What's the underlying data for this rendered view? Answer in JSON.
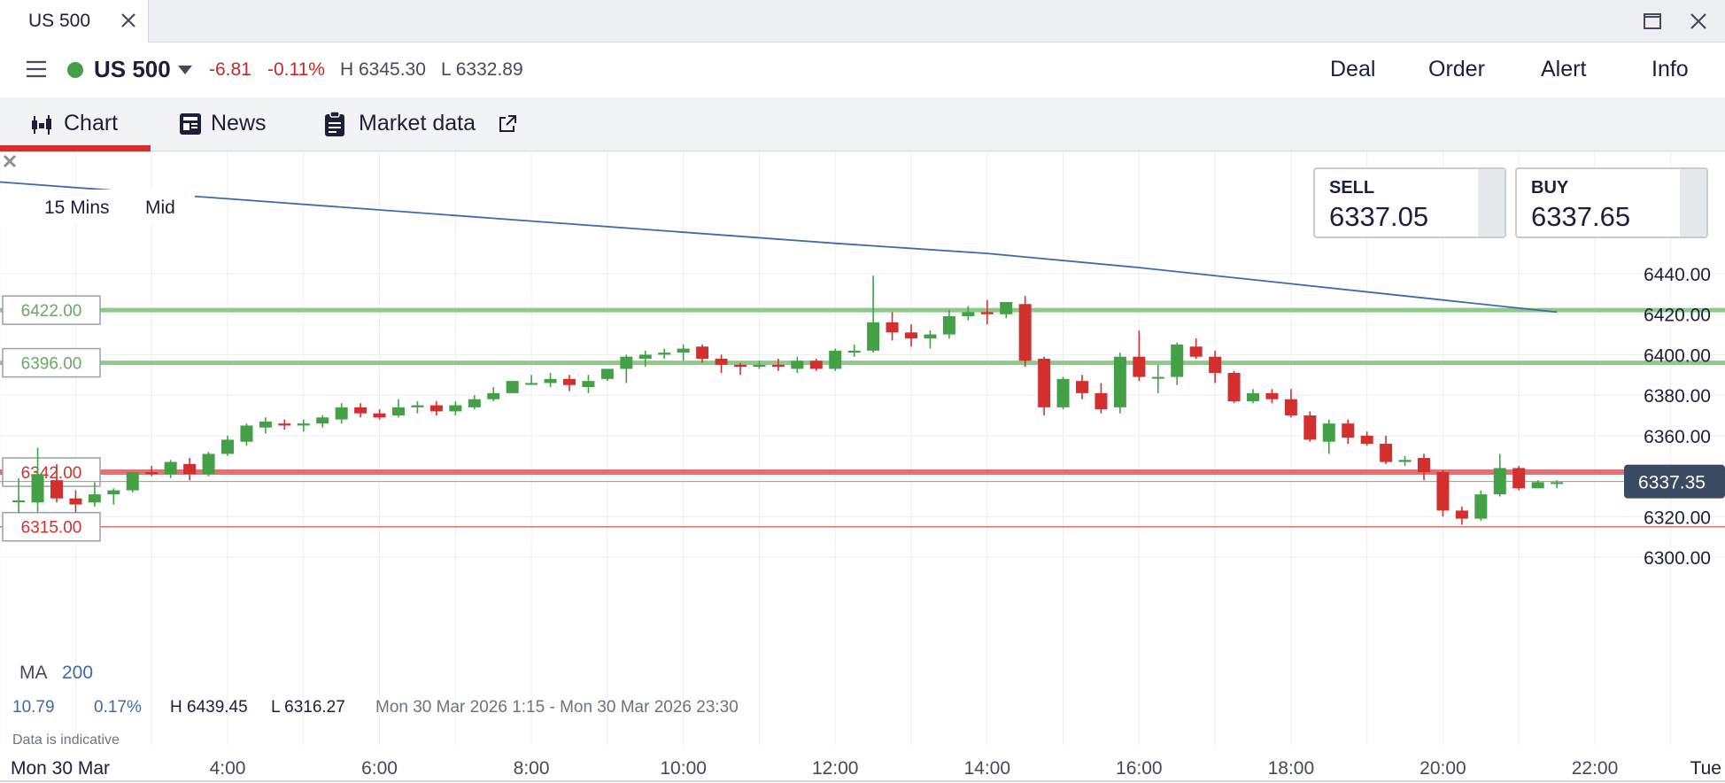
{
  "window": {
    "tab_title": "US 500"
  },
  "header": {
    "instrument": "US 500",
    "change": "-6.81",
    "change_pct": "-0.11%",
    "high": "H 6345.30",
    "low": "L 6332.89",
    "actions": [
      "Deal",
      "Order",
      "Alert",
      "Info"
    ]
  },
  "tabs": [
    {
      "label": "Chart",
      "active": true
    },
    {
      "label": "News",
      "active": false
    },
    {
      "label": "Market data",
      "active": false
    }
  ],
  "timeframe": {
    "interval": "15 Mins",
    "price_type": "Mid"
  },
  "quote": {
    "sell_label": "SELL",
    "sell_price": "6337.05",
    "buy_label": "BUY",
    "buy_price": "6337.65"
  },
  "indicator": {
    "name": "MA",
    "period": "200"
  },
  "stats": {
    "change": "10.79",
    "change_pct": "0.17%",
    "high": "H 6439.45",
    "low": "L 6316.27",
    "range": "Mon 30 Mar 2026 1:15 - Mon 30 Mar 2026 23:30"
  },
  "disclaimer": "Data is indicative",
  "colors": {
    "up": "#43a047",
    "down": "#d32f2f",
    "ma_line": "#3f6aa8",
    "price_tag": "#3b4a63",
    "accent": "#d32f2f"
  },
  "chart_data": {
    "type": "candlestick",
    "y_ticks": [
      "6440.00",
      "6420.00",
      "6400.00",
      "6380.00",
      "6360.00",
      "6320.00",
      "6300.00"
    ],
    "y_range": [
      6296,
      6486
    ],
    "x_ticks": [
      "4:00",
      "6:00",
      "8:00",
      "10:00",
      "12:00",
      "14:00",
      "16:00",
      "18:00",
      "20:00",
      "22:00"
    ],
    "x_start_label": "Mon 30 Mar",
    "x_end_label": "Tue",
    "current_price": "6337.35",
    "current_price_value": 6337.35,
    "levels": [
      {
        "label": "6422.00",
        "value": 6422,
        "kind": "green"
      },
      {
        "label": "6396.00",
        "value": 6396,
        "kind": "green"
      },
      {
        "label": "6342.00",
        "value": 6342,
        "kind": "red"
      },
      {
        "label": "6315.00",
        "value": 6315,
        "kind": "red-thin"
      }
    ],
    "candles": [
      {
        "t": "1:15",
        "o": 6328,
        "h": 6339,
        "l": 6322,
        "c": 6328
      },
      {
        "t": "1:30",
        "o": 6327,
        "h": 6354,
        "l": 6322,
        "c": 6341
      },
      {
        "t": "1:45",
        "o": 6338,
        "h": 6346,
        "l": 6327,
        "c": 6329
      },
      {
        "t": "2:00",
        "o": 6329,
        "h": 6333,
        "l": 6322,
        "c": 6326
      },
      {
        "t": "2:15",
        "o": 6327,
        "h": 6337,
        "l": 6325,
        "c": 6331
      },
      {
        "t": "2:30",
        "o": 6331,
        "h": 6334,
        "l": 6326,
        "c": 6333
      },
      {
        "t": "2:45",
        "o": 6333,
        "h": 6342,
        "l": 6332,
        "c": 6342
      },
      {
        "t": "3:00",
        "o": 6342,
        "h": 6345,
        "l": 6340,
        "c": 6341
      },
      {
        "t": "3:15",
        "o": 6341,
        "h": 6348,
        "l": 6339,
        "c": 6347
      },
      {
        "t": "3:30",
        "o": 6346,
        "h": 6349,
        "l": 6338,
        "c": 6341
      },
      {
        "t": "3:45",
        "o": 6341,
        "h": 6352,
        "l": 6340,
        "c": 6351
      },
      {
        "t": "4:00",
        "o": 6351,
        "h": 6360,
        "l": 6350,
        "c": 6358
      },
      {
        "t": "4:15",
        "o": 6357,
        "h": 6366,
        "l": 6355,
        "c": 6365
      },
      {
        "t": "4:30",
        "o": 6364,
        "h": 6369,
        "l": 6361,
        "c": 6367
      },
      {
        "t": "4:45",
        "o": 6366,
        "h": 6368,
        "l": 6363,
        "c": 6365
      },
      {
        "t": "5:00",
        "o": 6365,
        "h": 6368,
        "l": 6362,
        "c": 6366
      },
      {
        "t": "5:15",
        "o": 6366,
        "h": 6370,
        "l": 6364,
        "c": 6369
      },
      {
        "t": "5:30",
        "o": 6368,
        "h": 6376,
        "l": 6366,
        "c": 6374
      },
      {
        "t": "5:45",
        "o": 6374,
        "h": 6376,
        "l": 6369,
        "c": 6371
      },
      {
        "t": "6:00",
        "o": 6371,
        "h": 6373,
        "l": 6368,
        "c": 6369
      },
      {
        "t": "6:15",
        "o": 6370,
        "h": 6378,
        "l": 6369,
        "c": 6374
      },
      {
        "t": "6:30",
        "o": 6374,
        "h": 6377,
        "l": 6371,
        "c": 6375
      },
      {
        "t": "6:45",
        "o": 6375,
        "h": 6377,
        "l": 6370,
        "c": 6372
      },
      {
        "t": "7:00",
        "o": 6372,
        "h": 6377,
        "l": 6370,
        "c": 6375
      },
      {
        "t": "7:15",
        "o": 6374,
        "h": 6380,
        "l": 6373,
        "c": 6378
      },
      {
        "t": "7:30",
        "o": 6378,
        "h": 6384,
        "l": 6377,
        "c": 6381
      },
      {
        "t": "7:45",
        "o": 6381,
        "h": 6387,
        "l": 6381,
        "c": 6387
      },
      {
        "t": "8:00",
        "o": 6386,
        "h": 6390,
        "l": 6385,
        "c": 6386
      },
      {
        "t": "8:15",
        "o": 6386,
        "h": 6391,
        "l": 6384,
        "c": 6388
      },
      {
        "t": "8:30",
        "o": 6388,
        "h": 6390,
        "l": 6382,
        "c": 6385
      },
      {
        "t": "8:45",
        "o": 6384,
        "h": 6390,
        "l": 6381,
        "c": 6387
      },
      {
        "t": "9:00",
        "o": 6388,
        "h": 6393,
        "l": 6387,
        "c": 6393
      },
      {
        "t": "9:15",
        "o": 6393,
        "h": 6400,
        "l": 6386,
        "c": 6399
      },
      {
        "t": "9:30",
        "o": 6398,
        "h": 6402,
        "l": 6394,
        "c": 6400
      },
      {
        "t": "9:45",
        "o": 6400,
        "h": 6403,
        "l": 6398,
        "c": 6401
      },
      {
        "t": "10:00",
        "o": 6401,
        "h": 6405,
        "l": 6397,
        "c": 6403
      },
      {
        "t": "10:15",
        "o": 6404,
        "h": 6405,
        "l": 6396,
        "c": 6398
      },
      {
        "t": "10:30",
        "o": 6398,
        "h": 6400,
        "l": 6391,
        "c": 6395
      },
      {
        "t": "10:45",
        "o": 6395,
        "h": 6396,
        "l": 6390,
        "c": 6394
      },
      {
        "t": "11:00",
        "o": 6394,
        "h": 6397,
        "l": 6393,
        "c": 6395
      },
      {
        "t": "11:15",
        "o": 6395,
        "h": 6398,
        "l": 6392,
        "c": 6394
      },
      {
        "t": "11:30",
        "o": 6393,
        "h": 6399,
        "l": 6391,
        "c": 6397
      },
      {
        "t": "11:45",
        "o": 6397,
        "h": 6398,
        "l": 6392,
        "c": 6393
      },
      {
        "t": "12:00",
        "o": 6393,
        "h": 6403,
        "l": 6392,
        "c": 6402
      },
      {
        "t": "12:15",
        "o": 6401,
        "h": 6405,
        "l": 6399,
        "c": 6402
      },
      {
        "t": "12:30",
        "o": 6402,
        "h": 6439,
        "l": 6401,
        "c": 6416
      },
      {
        "t": "12:45",
        "o": 6416,
        "h": 6421,
        "l": 6407,
        "c": 6411
      },
      {
        "t": "13:00",
        "o": 6411,
        "h": 6415,
        "l": 6404,
        "c": 6408
      },
      {
        "t": "13:15",
        "o": 6408,
        "h": 6412,
        "l": 6403,
        "c": 6410
      },
      {
        "t": "13:30",
        "o": 6410,
        "h": 6422,
        "l": 6408,
        "c": 6419
      },
      {
        "t": "13:45",
        "o": 6419,
        "h": 6424,
        "l": 6417,
        "c": 6421
      },
      {
        "t": "14:00",
        "o": 6421,
        "h": 6427,
        "l": 6415,
        "c": 6420
      },
      {
        "t": "14:15",
        "o": 6420,
        "h": 6425,
        "l": 6418,
        "c": 6426
      },
      {
        "t": "14:30",
        "o": 6425,
        "h": 6429,
        "l": 6394,
        "c": 6397
      },
      {
        "t": "14:45",
        "o": 6398,
        "h": 6399,
        "l": 6370,
        "c": 6374
      },
      {
        "t": "15:00",
        "o": 6374,
        "h": 6389,
        "l": 6373,
        "c": 6388
      },
      {
        "t": "15:15",
        "o": 6387,
        "h": 6390,
        "l": 6378,
        "c": 6381
      },
      {
        "t": "15:30",
        "o": 6381,
        "h": 6386,
        "l": 6371,
        "c": 6373
      },
      {
        "t": "15:45",
        "o": 6374,
        "h": 6401,
        "l": 6371,
        "c": 6399
      },
      {
        "t": "16:00",
        "o": 6399,
        "h": 6412,
        "l": 6387,
        "c": 6389
      },
      {
        "t": "16:15",
        "o": 6389,
        "h": 6395,
        "l": 6381,
        "c": 6389
      },
      {
        "t": "16:30",
        "o": 6389,
        "h": 6406,
        "l": 6385,
        "c": 6405
      },
      {
        "t": "16:45",
        "o": 6404,
        "h": 6408,
        "l": 6398,
        "c": 6399
      },
      {
        "t": "17:00",
        "o": 6399,
        "h": 6402,
        "l": 6386,
        "c": 6391
      },
      {
        "t": "17:15",
        "o": 6391,
        "h": 6392,
        "l": 6376,
        "c": 6377
      },
      {
        "t": "17:30",
        "o": 6377,
        "h": 6383,
        "l": 6376,
        "c": 6381
      },
      {
        "t": "17:45",
        "o": 6381,
        "h": 6383,
        "l": 6376,
        "c": 6378
      },
      {
        "t": "18:00",
        "o": 6378,
        "h": 6383,
        "l": 6369,
        "c": 6370
      },
      {
        "t": "18:15",
        "o": 6370,
        "h": 6372,
        "l": 6357,
        "c": 6358
      },
      {
        "t": "18:30",
        "o": 6357,
        "h": 6368,
        "l": 6351,
        "c": 6366
      },
      {
        "t": "18:45",
        "o": 6366,
        "h": 6368,
        "l": 6356,
        "c": 6359
      },
      {
        "t": "19:00",
        "o": 6360,
        "h": 6362,
        "l": 6355,
        "c": 6356
      },
      {
        "t": "19:15",
        "o": 6356,
        "h": 6360,
        "l": 6346,
        "c": 6347
      },
      {
        "t": "19:30",
        "o": 6347,
        "h": 6350,
        "l": 6345,
        "c": 6348
      },
      {
        "t": "19:45",
        "o": 6349,
        "h": 6351,
        "l": 6338,
        "c": 6342
      },
      {
        "t": "20:00",
        "o": 6342,
        "h": 6343,
        "l": 6320,
        "c": 6323
      },
      {
        "t": "20:15",
        "o": 6323,
        "h": 6325,
        "l": 6316,
        "c": 6319
      },
      {
        "t": "20:30",
        "o": 6319,
        "h": 6333,
        "l": 6318,
        "c": 6331
      },
      {
        "t": "20:45",
        "o": 6331,
        "h": 6351,
        "l": 6330,
        "c": 6344
      },
      {
        "t": "21:00",
        "o": 6344,
        "h": 6345,
        "l": 6333,
        "c": 6334
      },
      {
        "t": "21:15",
        "o": 6334,
        "h": 6338,
        "l": 6334,
        "c": 6337
      },
      {
        "t": "21:30",
        "o": 6337,
        "h": 6338,
        "l": 6334,
        "c": 6337
      }
    ],
    "ma_200": [
      {
        "t": "0:45",
        "v": 6486
      },
      {
        "t": "4:00",
        "v": 6477
      },
      {
        "t": "8:00",
        "v": 6466
      },
      {
        "t": "12:00",
        "v": 6455
      },
      {
        "t": "14:00",
        "v": 6450
      },
      {
        "t": "16:00",
        "v": 6443
      },
      {
        "t": "18:00",
        "v": 6435
      },
      {
        "t": "20:00",
        "v": 6427
      },
      {
        "t": "21:30",
        "v": 6421
      }
    ]
  }
}
